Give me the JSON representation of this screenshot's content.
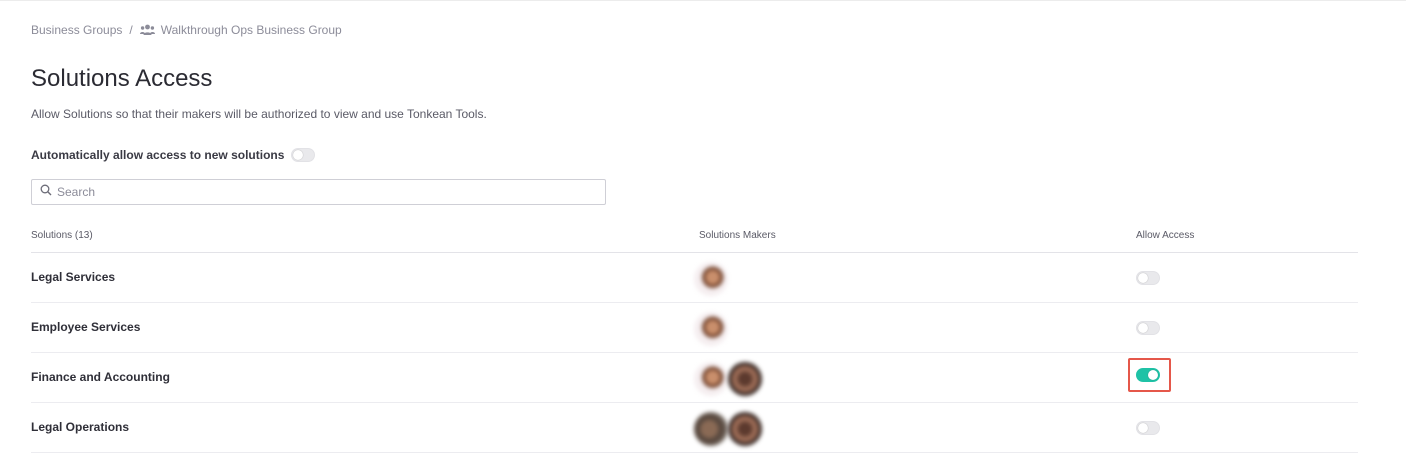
{
  "breadcrumb": {
    "root": "Business Groups",
    "separator": "/",
    "current": "Walkthrough Ops Business Group",
    "current_icon": "group-icon"
  },
  "page": {
    "title": "Solutions Access",
    "subtitle": "Allow Solutions so that their makers will be authorized to view and use Tonkean Tools."
  },
  "auto_allow": {
    "label": "Automatically allow access to new solutions",
    "enabled": false
  },
  "search": {
    "placeholder": "Search",
    "value": "",
    "icon": "search-icon"
  },
  "table": {
    "headers": {
      "solutions": "Solutions (13)",
      "makers": "Solutions Makers",
      "access": "Allow Access"
    },
    "rows": [
      {
        "name": "Legal Services",
        "makers": 1,
        "allow_access": false
      },
      {
        "name": "Employee Services",
        "makers": 1,
        "allow_access": false
      },
      {
        "name": "Finance and Accounting",
        "makers": 2,
        "allow_access": true,
        "highlighted": true
      },
      {
        "name": "Legal Operations",
        "makers": 2,
        "allow_access": false
      }
    ]
  },
  "colors": {
    "toggle_on": "#1fc2a6",
    "highlight_border": "#e5574a",
    "text_muted": "#8c8c99"
  }
}
